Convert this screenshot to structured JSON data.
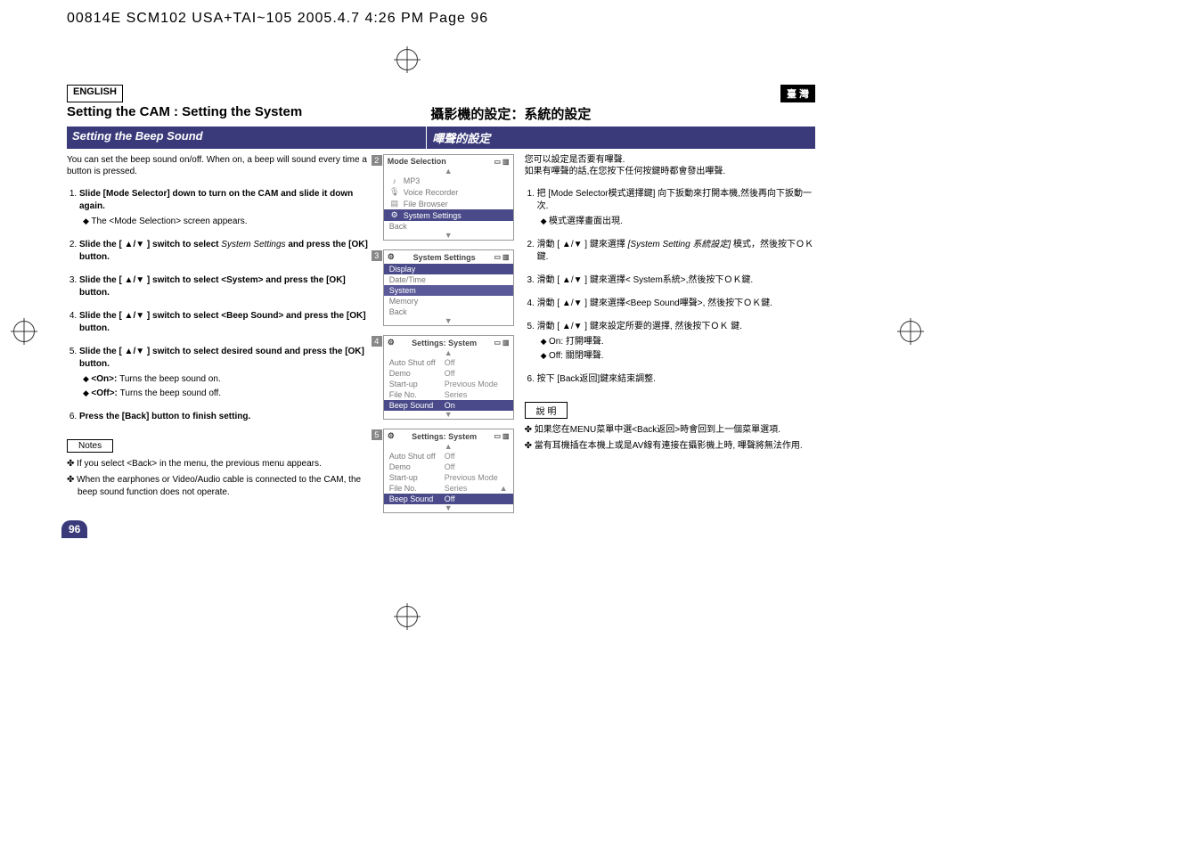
{
  "header": "00814E SCM102 USA+TAI~105 2005.4.7 4:26 PM Page 96",
  "lang": {
    "en": "ENGLISH",
    "tw": "臺 灣"
  },
  "title": {
    "en": "Setting the CAM : Setting the System",
    "tw": "攝影機的設定：系統的設定"
  },
  "subtitle": {
    "en": "Setting the Beep Sound",
    "tw": "嗶聲的設定"
  },
  "intro": {
    "en": "You can set the beep sound on/off. When on, a beep will sound every time a button is pressed.",
    "tw1": "您可以設定是否要有嗶聲.",
    "tw2": "如果有嗶聲的話,在您按下任何按鍵時都會發出嗶聲."
  },
  "steps_en": {
    "s1a": "Slide [Mode Selector] down to turn on the CAM and slide it down again.",
    "s1b": "The <Mode Selection> screen appears.",
    "s2a": "Slide the [ ▲/▼ ] switch to select ",
    "s2i": "System Settings",
    "s2b": " and press the [OK] button.",
    "s3": "Slide the [ ▲/▼ ] switch to select <System> and press the [OK] button.",
    "s4": "Slide the [ ▲/▼ ] switch to select <Beep Sound> and press the [OK] button.",
    "s5a": "Slide the [ ▲/▼ ] switch to select desired sound and press the [OK] button.",
    "s5on": "<On>: ",
    "s5onb": "Turns the beep sound on.",
    "s5off": "<Off>: ",
    "s5offb": "Turns the beep sound off.",
    "s6": "Press the [Back] button to finish setting."
  },
  "steps_tw": {
    "s1a": "把 [Mode Selector模式選擇鍵] 向下扳動來打開本機,然後再向下扳動一次.",
    "s1b": "模式選擇畫面出現.",
    "s2a": "滑動 [ ▲/▼ ] 鍵來選擇 ",
    "s2i": "[System Setting 系統設定]",
    "s2b": " 模式，然後按下ＯＫ鍵.",
    "s3": "滑動 [ ▲/▼ ] 鍵來選擇< System系統>,然後按下ＯＫ鍵.",
    "s4": "滑動 [ ▲/▼ ] 鍵來選擇<Beep Sound嗶聲>, 然後按下ＯＫ鍵.",
    "s5a": "滑動 [ ▲/▼ ] 鍵來設定所要的選擇, 然後按下ＯＫ 鍵.",
    "s5on": "On: 打開嗶聲.",
    "s5off": "Off: 關閉嗶聲.",
    "s6": "按下 [Back返回]鍵來結束調整."
  },
  "notes_title": {
    "en": "Notes",
    "tw": "說 明"
  },
  "notes_en": {
    "n1": "If you select <Back> in the menu, the previous menu appears.",
    "n2": "When the earphones or Video/Audio cable is connected to the CAM, the beep sound function does not operate."
  },
  "notes_tw": {
    "n1": "如果您在MENU菜單中選<Back返回>時會回到上一個菜單選項.",
    "n2": "當有耳機插在本機上或是AV線有連接在攝影機上時, 嗶聲將無法作用."
  },
  "screens": {
    "s2": {
      "title": "Mode Selection",
      "r1": "MP3",
      "r2": "Voice Recorder",
      "r3": "File Browser",
      "r4": "System Settings",
      "r5": "Back"
    },
    "s3": {
      "title": "System Settings",
      "r1": "Display",
      "r2": "Date/Time",
      "r3": "System",
      "r4": "Memory",
      "r5": "Back"
    },
    "s4": {
      "title": "Settings: System",
      "k1": "Auto Shut off",
      "v1": "Off",
      "k2": "Demo",
      "v2": "Off",
      "k3": "Start-up",
      "v3": "Previous Mode",
      "k4": "File No.",
      "v4": "Series",
      "k5": "Beep Sound",
      "v5": "On"
    },
    "s5": {
      "title": "Settings: System",
      "k1": "Auto Shut off",
      "v1": "Off",
      "k2": "Demo",
      "v2": "Off",
      "k3": "Start-up",
      "v3": "Previous Mode",
      "k4": "File No.",
      "v4": "Series",
      "k5": "Beep Sound",
      "v5": "Off"
    }
  },
  "icons": {
    "storage": "▭",
    "battery": "▮▯▯",
    "tool_small": "♪",
    "mic": "🎤",
    "folder": "▤",
    "gear": "⚙"
  },
  "pagenum": "96"
}
